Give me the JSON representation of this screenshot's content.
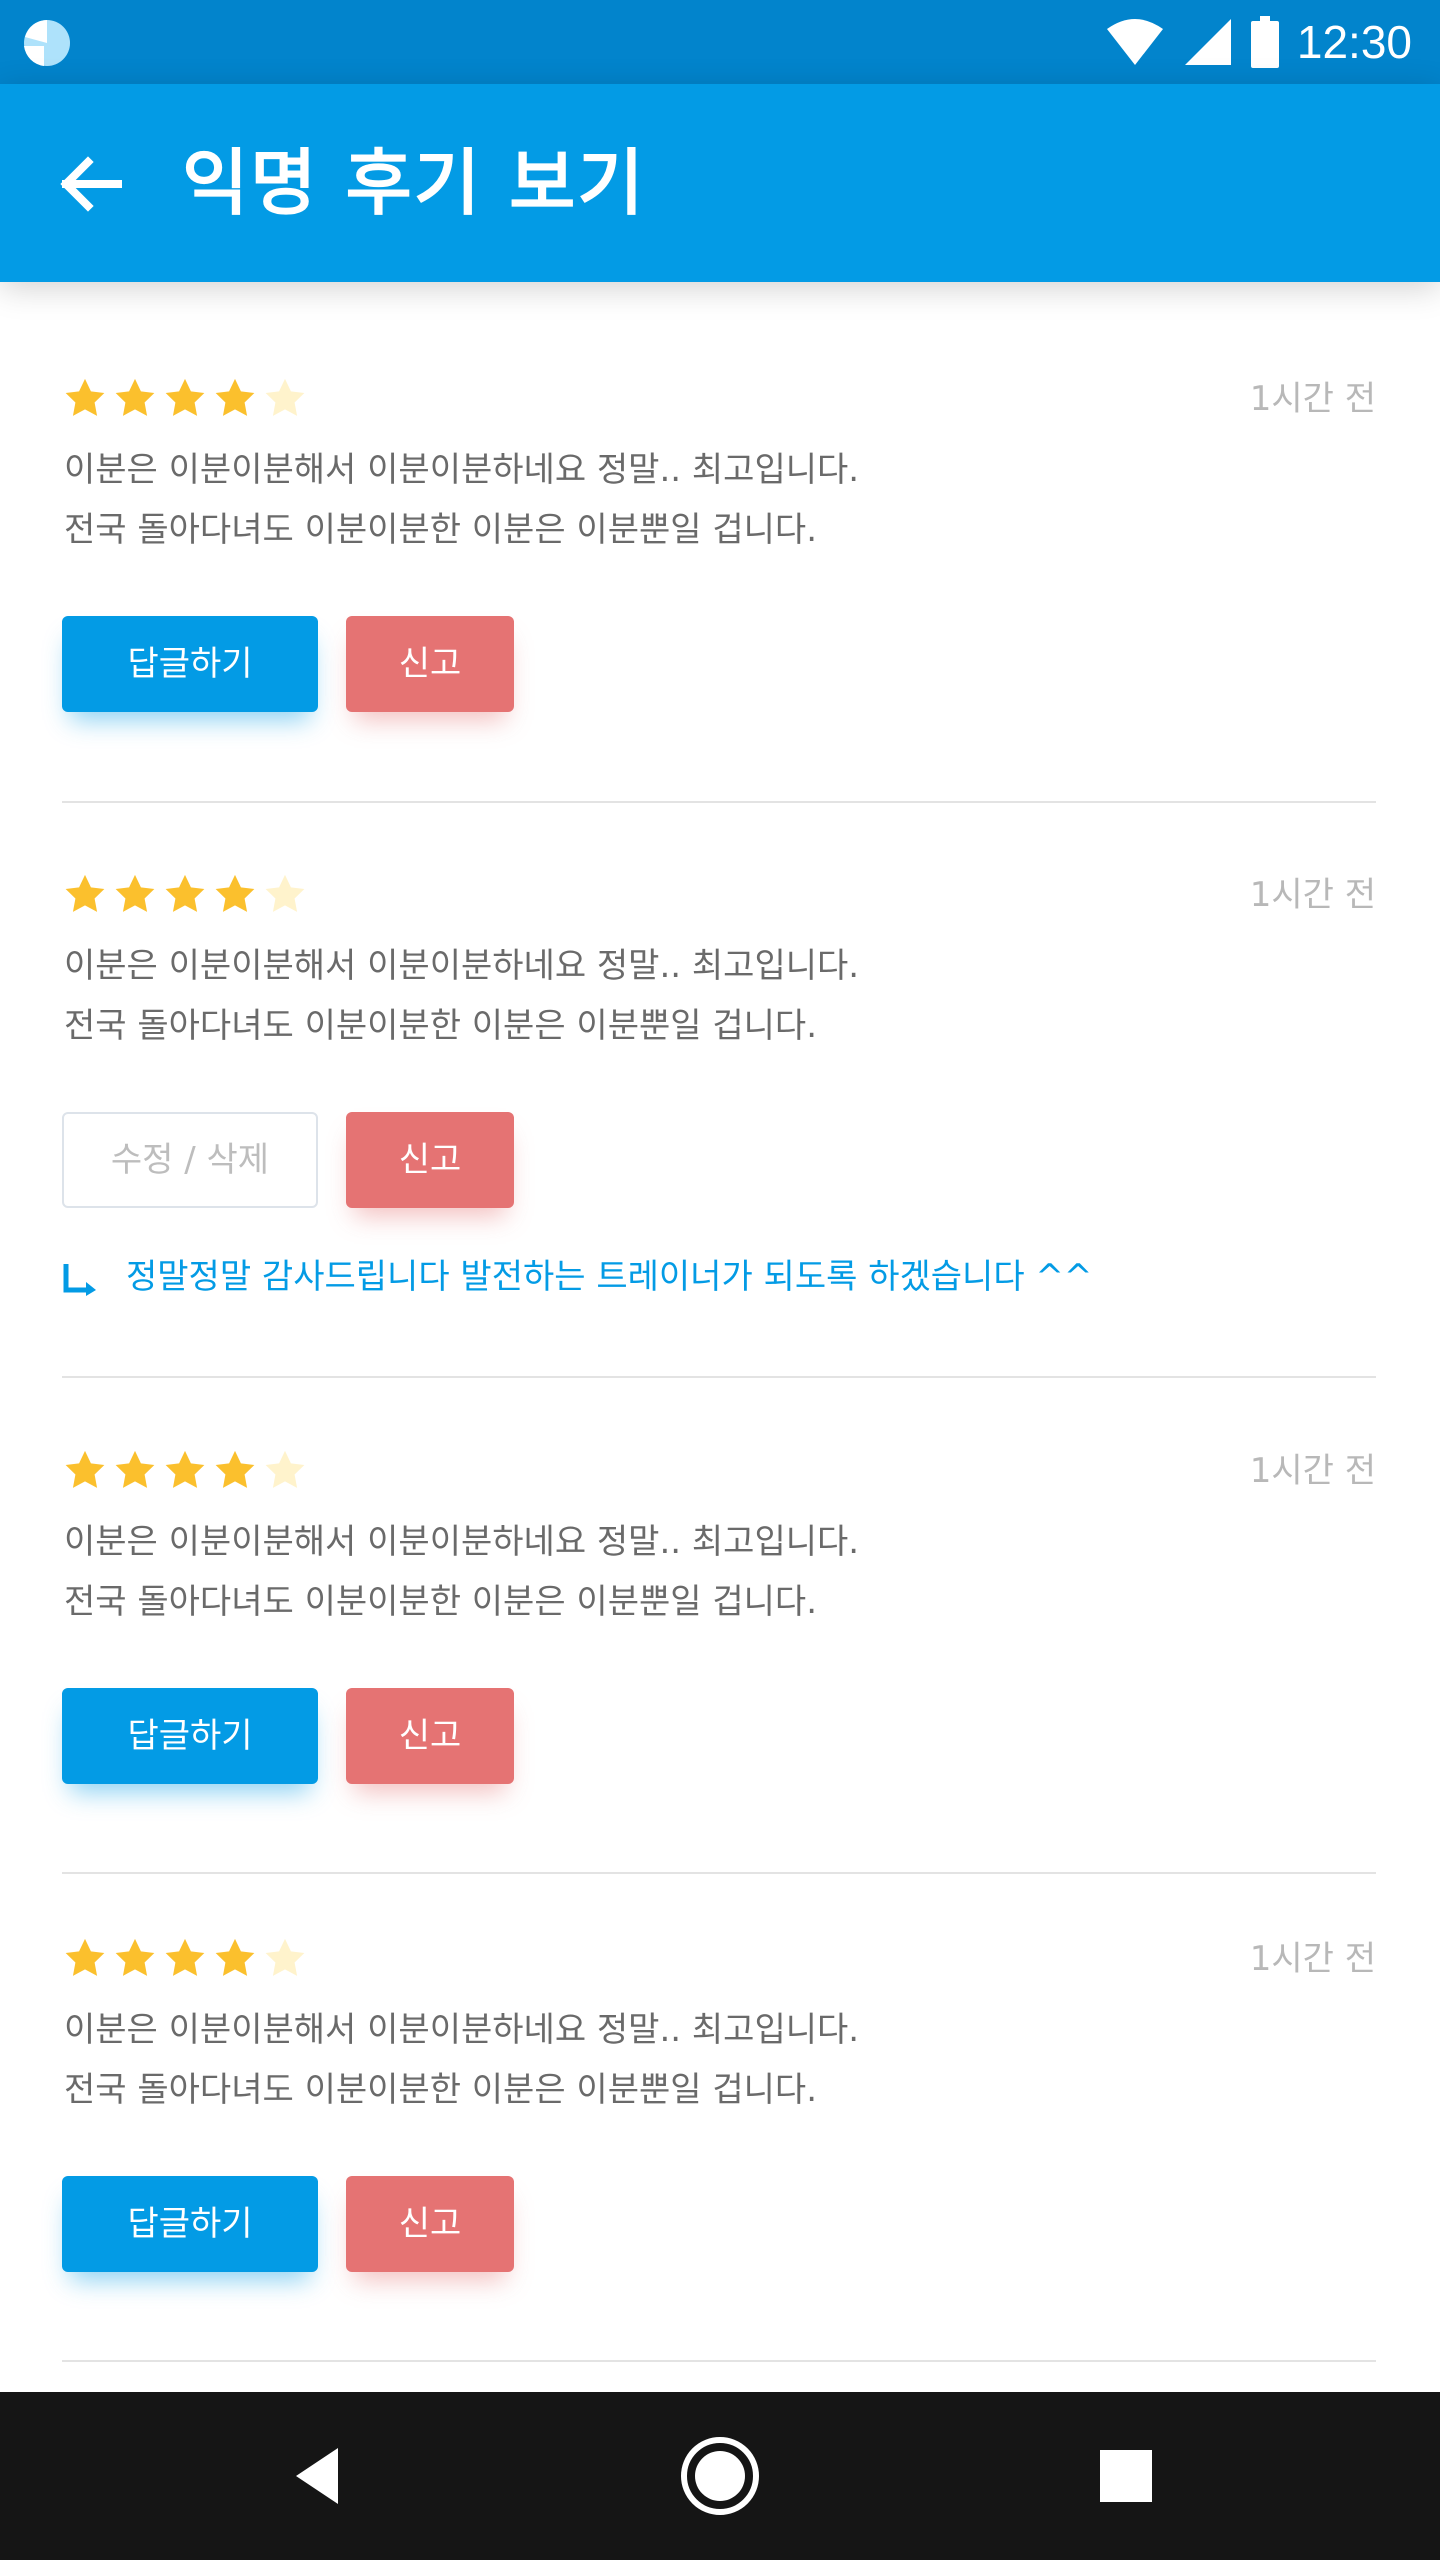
{
  "status_bar": {
    "time": "12:30",
    "icons": [
      "app-logo-icon",
      "wifi-icon",
      "signal-icon",
      "battery-icon"
    ]
  },
  "app_bar": {
    "title": "익명 후기 보기",
    "back_icon": "arrow-back-icon"
  },
  "reviews": [
    {
      "rating": 4,
      "max_rating": 5,
      "time": "1시간 전",
      "line1": "이분은 이분이분해서 이분이분하네요 정말.. 최고입니다.",
      "line2": "전국 돌아다녀도 이분이분한 이분은 이분뿐일 겁니다.",
      "primary_button": "답글하기",
      "report_button": "신고"
    },
    {
      "rating": 4,
      "max_rating": 5,
      "time": "1시간 전",
      "line1": "이분은 이분이분해서 이분이분하네요 정말.. 최고입니다.",
      "line2": "전국 돌아다녀도 이분이분한 이분은 이분뿐일 겁니다.",
      "primary_button": "수정 / 삭제",
      "report_button": "신고",
      "reply": "정말정말 감사드립니다 발전하는 트레이너가 되도록 하겠습니다 ^^"
    },
    {
      "rating": 4,
      "max_rating": 5,
      "time": "1시간 전",
      "line1": "이분은 이분이분해서 이분이분하네요 정말.. 최고입니다.",
      "line2": "전국 돌아다녀도 이분이분한 이분은 이분뿐일 겁니다.",
      "primary_button": "답글하기",
      "report_button": "신고"
    },
    {
      "rating": 4,
      "max_rating": 5,
      "time": "1시간 전",
      "line1": "이분은 이분이분해서 이분이분하네요 정말.. 최고입니다.",
      "line2": "전국 돌아다녀도 이분이분한 이분은 이분뿐일 겁니다.",
      "primary_button": "답글하기",
      "report_button": "신고"
    }
  ],
  "colors": {
    "status_bar": "#0284cc",
    "app_bar": "#039be5",
    "star_filled": "#fbc02d",
    "star_empty": "#fff3cc",
    "report": "#e57373",
    "nav_bar": "#151515"
  },
  "nav_bar": {
    "icons": [
      "back-triangle-icon",
      "home-circle-icon",
      "recents-square-icon"
    ]
  }
}
